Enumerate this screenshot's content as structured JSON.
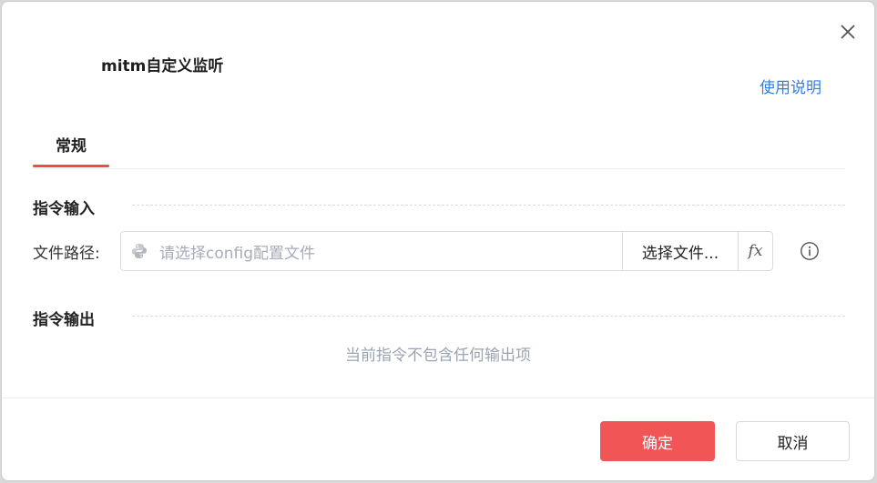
{
  "dialog": {
    "title": "mitm自定义监听",
    "help_link": "使用说明"
  },
  "tabs": [
    {
      "label": "常规",
      "active": true
    }
  ],
  "input_section": {
    "title": "指令输入",
    "path_label": "文件路径:",
    "path_placeholder": "请选择config配置文件",
    "choose_button": "选择文件...",
    "fx_label": "fx"
  },
  "output_section": {
    "title": "指令输出",
    "empty_text": "当前指令不包含任何输出项"
  },
  "footer": {
    "ok_label": "确定",
    "cancel_label": "取消"
  },
  "colors": {
    "accent": "#f25556",
    "link": "#2f7fe6"
  }
}
